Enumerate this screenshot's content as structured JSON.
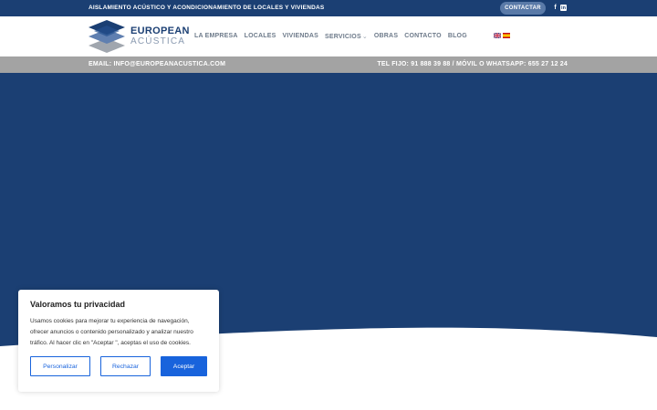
{
  "topbar": {
    "tagline": "AISLAMIENTO ACÚSTICO Y ACONDICIONAMIENTO DE LOCALES Y VIVIENDAS",
    "contact_label": "CONTACTAR",
    "facebook_glyph": "f",
    "linkedin_glyph": "in"
  },
  "header": {
    "brand_line1": "EUROPEAN",
    "brand_line2": "ACÚSTICA",
    "nav": [
      "LA EMPRESA",
      "LOCALES",
      "VIVIENDAS",
      "SERVICIOS",
      "OBRAS",
      "CONTACTO",
      "BLOG"
    ],
    "services_caret": "⌄"
  },
  "infobar": {
    "email": "EMAIL: INFO@EUROPEANACUSTICA.COM",
    "phone": "TEL FIJO: 91 888 39 88 / MÓVIL O WHATSAPP: 655 27 12 24"
  },
  "colors": {
    "primary": "#1b3f73",
    "infobar": "#a3a3a3",
    "cookie_accent": "#1863dc"
  },
  "cookie": {
    "title": "Valoramos tu privacidad",
    "body": "Usamos cookies para mejorar tu experiencia de navegación, ofrecer anuncios o contenido personalizado y analizar nuestro tráfico. Al hacer clic en \"Aceptar \", aceptas el uso de cookies.",
    "customize": "Personalizar",
    "reject": "Rechazar",
    "accept": "Aceptar"
  }
}
